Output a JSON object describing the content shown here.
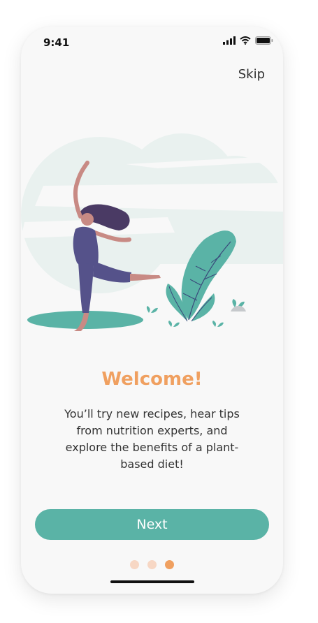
{
  "status_bar": {
    "time": "9:41"
  },
  "header": {
    "skip_label": "Skip"
  },
  "onboarding": {
    "title": "Welcome!",
    "description": "You’ll try new recipes, hear tips from nutrition experts, and explore the benefits of a plant-based diet!",
    "next_label": "Next"
  },
  "pagination": {
    "total": 3,
    "active": 3
  },
  "colors": {
    "accent": "#f0a060",
    "primary": "#5ab3a6",
    "dot_inactive": "#f7d7c4",
    "dot_active": "#f0a060"
  }
}
